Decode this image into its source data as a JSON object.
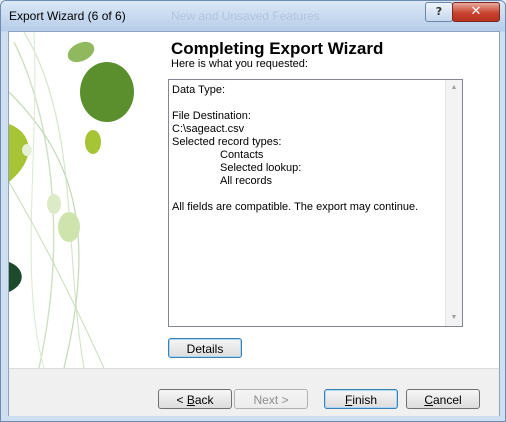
{
  "window": {
    "title": "Export Wizard (6 of 6)",
    "background_title": "New and Unsaved Features"
  },
  "titlebar": {
    "help_label": "?",
    "close_label": "✕"
  },
  "wizard": {
    "heading": "Completing Export Wizard",
    "subheading": "Here is what you requested:",
    "summary_lines": [
      {
        "text": "Data Type:",
        "indent": false
      },
      {
        "text": "",
        "indent": false
      },
      {
        "text": "File Destination:",
        "indent": false
      },
      {
        "text": "C:\\sageact.csv",
        "indent": false
      },
      {
        "text": "Selected record types:",
        "indent": false
      },
      {
        "text": "Contacts",
        "indent": true
      },
      {
        "text": "Selected lookup:",
        "indent": true
      },
      {
        "text": "All records",
        "indent": true
      },
      {
        "text": "",
        "indent": false
      },
      {
        "text": "All fields are compatible. The export may continue.",
        "indent": false
      }
    ],
    "details_label": "Details"
  },
  "buttons": {
    "back": {
      "label": "Back",
      "accel": "B",
      "prefix": "< "
    },
    "next": {
      "label": "Next >"
    },
    "finish": {
      "label": "Finish",
      "accel": "F"
    },
    "cancel": {
      "label": "Cancel",
      "accel": "C"
    }
  },
  "colors": {
    "leaf_green": "#5b8f2e",
    "leaf_lime": "#a6c436",
    "leaf_dark": "#1e4a2c"
  }
}
